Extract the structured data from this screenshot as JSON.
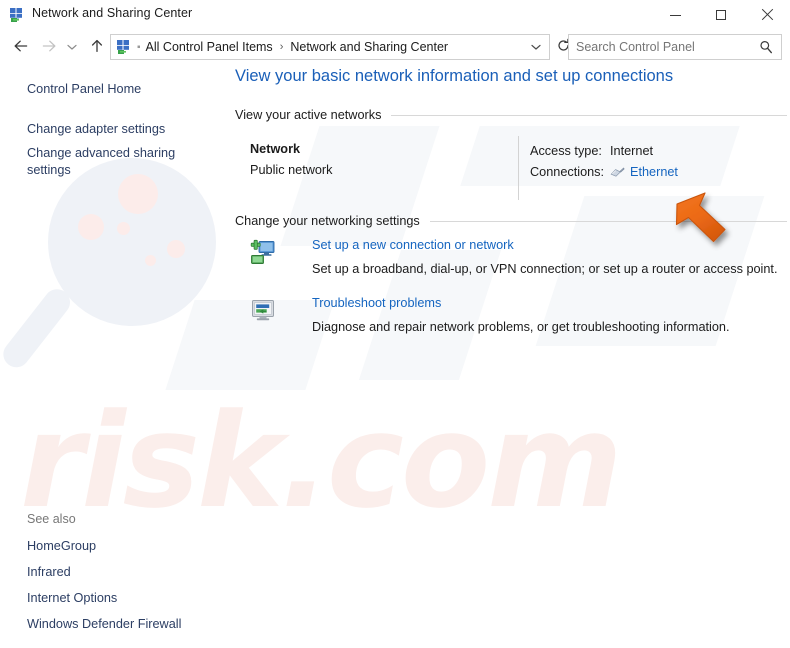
{
  "window": {
    "title": "Network and Sharing Center",
    "icon": "network-sharing-icon",
    "minimize_label": "Minimize",
    "maximize_label": "Maximize",
    "close_label": "Close"
  },
  "navbar": {
    "back_label": "Back",
    "forward_label": "Forward",
    "recent_label": "Recent locations",
    "up_label": "Up",
    "breadcrumb": {
      "icon": "network-sharing-icon",
      "separator": "›",
      "items": [
        {
          "label": "All Control Panel Items"
        },
        {
          "label": "Network and Sharing Center"
        }
      ],
      "dropdown_icon": "chevron-down-icon"
    },
    "refresh_label": "Refresh",
    "refresh_icon": "refresh-icon"
  },
  "search": {
    "placeholder": "Search Control Panel",
    "value": "",
    "icon": "search-icon"
  },
  "sidebar": {
    "items": [
      {
        "label": "Control Panel Home"
      },
      {
        "label": "Change adapter settings"
      },
      {
        "label": "Change advanced sharing settings"
      }
    ],
    "see_also": {
      "label": "See also",
      "items": [
        {
          "label": "HomeGroup"
        },
        {
          "label": "Infrared"
        },
        {
          "label": "Internet Options"
        },
        {
          "label": "Windows Defender Firewall"
        }
      ]
    }
  },
  "main": {
    "page_title": "View your basic network information and set up connections",
    "sections": [
      {
        "heading": "View your active networks"
      },
      {
        "heading": "Change your networking settings"
      }
    ],
    "active_network": {
      "name": "Network",
      "type": "Public network",
      "details": [
        {
          "label": "Access type:",
          "value": "Internet",
          "is_link": false
        },
        {
          "label": "Connections:",
          "value": "Ethernet",
          "is_link": true,
          "icon": "ethernet-icon"
        }
      ]
    },
    "tasks": [
      {
        "icon": "new-connection-icon",
        "title": "Set up a new connection or network",
        "description": "Set up a broadband, dial-up, or VPN connection; or set up a router or access point."
      },
      {
        "icon": "troubleshoot-icon",
        "title": "Troubleshoot problems",
        "description": "Diagnose and repair network problems, or get troubleshooting information."
      }
    ]
  },
  "annotation": {
    "pointer_icon": "orange-arrow-cursor",
    "pointer_color": "#ee6c1f"
  },
  "watermark": {
    "text": "risk.com",
    "text_color": "#fbeeeb",
    "glass_color": "#eff2f7",
    "dot_color": "#fcecea"
  },
  "colors": {
    "title_blue": "#1a5fb8",
    "link_blue": "#1565c0",
    "sidebar_navy": "#2c3e63",
    "body_text": "#1c1c1c",
    "muted_text": "#777777",
    "window_bg": "#ffffff",
    "border": "#cfcfcf"
  }
}
